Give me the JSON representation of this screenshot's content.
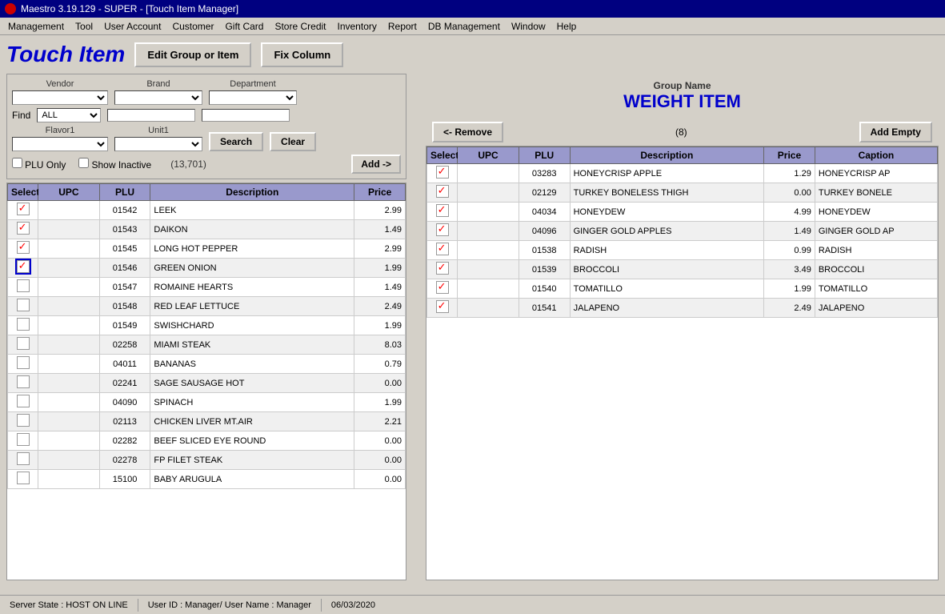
{
  "titleBar": {
    "icon": "app-icon",
    "title": "Maestro 3.19.129 - SUPER - [Touch Item Manager]"
  },
  "menuBar": {
    "items": [
      "Management",
      "Tool",
      "User Account",
      "Customer",
      "Gift Card",
      "Store Credit",
      "Inventory",
      "Report",
      "DB Management",
      "Window",
      "Help"
    ]
  },
  "header": {
    "title": "Touch Item",
    "editGroupBtn": "Edit Group or Item",
    "fixColumnBtn": "Fix Column"
  },
  "filters": {
    "vendorLabel": "Vendor",
    "brandLabel": "Brand",
    "departmentLabel": "Department",
    "findLabel": "Find",
    "findValue": "ALL",
    "flavor1Label": "Flavor1",
    "unit1Label": "Unit1",
    "searchBtn": "Search",
    "clearBtn": "Clear",
    "addBtn": "Add ->",
    "pluOnlyLabel": "PLU Only",
    "showInactiveLabel": "Show Inactive",
    "countLabel": "(13,701)"
  },
  "leftTable": {
    "columns": [
      "Select",
      "UPC",
      "PLU",
      "Description",
      "Price"
    ],
    "rows": [
      {
        "select": true,
        "upc": "",
        "plu": "01542",
        "desc": "LEEK",
        "price": "2.99"
      },
      {
        "select": true,
        "upc": "",
        "plu": "01543",
        "desc": "DAIKON",
        "price": "1.49"
      },
      {
        "select": true,
        "upc": "",
        "plu": "01545",
        "desc": "LONG HOT PEPPER",
        "price": "2.99"
      },
      {
        "select": true,
        "focused": true,
        "upc": "",
        "plu": "01546",
        "desc": "GREEN ONION",
        "price": "1.99"
      },
      {
        "select": false,
        "upc": "",
        "plu": "01547",
        "desc": "ROMAINE HEARTS",
        "price": "1.49"
      },
      {
        "select": false,
        "upc": "",
        "plu": "01548",
        "desc": "RED LEAF LETTUCE",
        "price": "2.49"
      },
      {
        "select": false,
        "upc": "",
        "plu": "01549",
        "desc": "SWISHCHARD",
        "price": "1.99"
      },
      {
        "select": false,
        "upc": "",
        "plu": "02258",
        "desc": "MIAMI STEAK",
        "price": "8.03"
      },
      {
        "select": false,
        "upc": "",
        "plu": "04011",
        "desc": "BANANAS",
        "price": "0.79"
      },
      {
        "select": false,
        "upc": "",
        "plu": "02241",
        "desc": "SAGE SAUSAGE HOT",
        "price": "0.00"
      },
      {
        "select": false,
        "upc": "",
        "plu": "04090",
        "desc": "SPINACH",
        "price": "1.99"
      },
      {
        "select": false,
        "upc": "",
        "plu": "02113",
        "desc": "CHICKEN LIVER MT.AIR",
        "price": "2.21"
      },
      {
        "select": false,
        "upc": "",
        "plu": "02282",
        "desc": "BEEF SLICED EYE ROUND",
        "price": "0.00"
      },
      {
        "select": false,
        "upc": "",
        "plu": "02278",
        "desc": "FP FILET STEAK",
        "price": "0.00"
      },
      {
        "select": false,
        "upc": "",
        "plu": "15100",
        "desc": "BABY ARUGULA",
        "price": "0.00"
      }
    ]
  },
  "rightPanel": {
    "groupNameLabel": "Group Name",
    "groupName": "WEIGHT ITEM",
    "removeBtn": "<- Remove",
    "count": "(8)",
    "addEmptyBtn": "Add Empty",
    "columns": [
      "Select",
      "UPC",
      "PLU",
      "Description",
      "Price",
      "Caption"
    ],
    "rows": [
      {
        "select": true,
        "upc": "",
        "plu": "03283",
        "desc": "HONEYCRISP APPLE",
        "price": "1.29",
        "caption": "HONEYCRISP AP"
      },
      {
        "select": true,
        "upc": "",
        "plu": "02129",
        "desc": "TURKEY BONELESS THIGH",
        "price": "0.00",
        "caption": "TURKEY BONELE"
      },
      {
        "select": true,
        "upc": "",
        "plu": "04034",
        "desc": "HONEYDEW",
        "price": "4.99",
        "caption": "HONEYDEW"
      },
      {
        "select": true,
        "upc": "",
        "plu": "04096",
        "desc": "GINGER GOLD APPLES",
        "price": "1.49",
        "caption": "GINGER GOLD AP"
      },
      {
        "select": true,
        "upc": "",
        "plu": "01538",
        "desc": "RADISH",
        "price": "0.99",
        "caption": "RADISH"
      },
      {
        "select": true,
        "upc": "",
        "plu": "01539",
        "desc": "BROCCOLI",
        "price": "3.49",
        "caption": "BROCCOLI"
      },
      {
        "select": true,
        "upc": "",
        "plu": "01540",
        "desc": "TOMATILLO",
        "price": "1.99",
        "caption": "TOMATILLO"
      },
      {
        "select": true,
        "upc": "",
        "plu": "01541",
        "desc": "JALAPENO",
        "price": "2.49",
        "caption": "JALAPENO"
      }
    ]
  },
  "statusBar": {
    "serverState": "Server State : HOST ON LINE",
    "userInfo": "User ID : Manager/ User Name : Manager",
    "date": "06/03/2020"
  }
}
